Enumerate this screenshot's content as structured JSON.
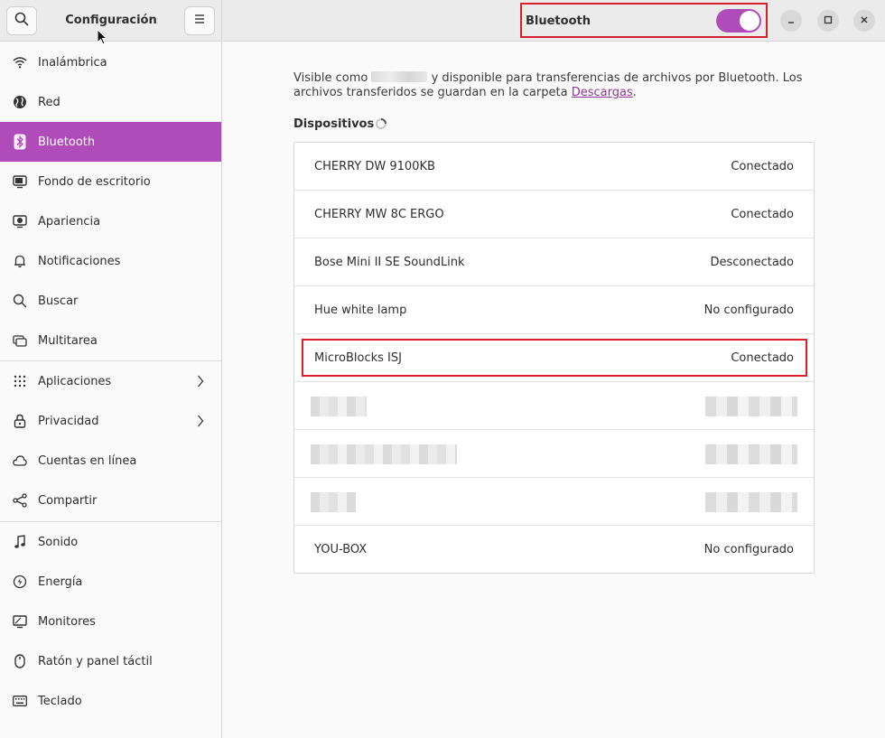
{
  "window": {
    "app_title": "Configuración",
    "panel_title": "Bluetooth",
    "bluetooth_enabled": true,
    "accent_color": "#b04cba"
  },
  "sidebar": {
    "items": [
      {
        "label": "Inalámbrica",
        "icon": "wifi-icon"
      },
      {
        "label": "Red",
        "icon": "globe-icon"
      },
      {
        "label": "Bluetooth",
        "icon": "bluetooth-icon",
        "selected": true
      },
      {
        "label": "Fondo de escritorio",
        "icon": "wallpaper-icon"
      },
      {
        "label": "Apariencia",
        "icon": "appearance-icon"
      },
      {
        "label": "Notificaciones",
        "icon": "bell-icon"
      },
      {
        "label": "Buscar",
        "icon": "search-icon"
      },
      {
        "label": "Multitarea",
        "icon": "multitask-icon"
      },
      {
        "label": "Aplicaciones",
        "icon": "apps-grid-icon",
        "has_submenu": true
      },
      {
        "label": "Privacidad",
        "icon": "lock-icon",
        "has_submenu": true
      },
      {
        "label": "Cuentas en línea",
        "icon": "cloud-icon"
      },
      {
        "label": "Compartir",
        "icon": "share-icon"
      },
      {
        "label": "Sonido",
        "icon": "music-note-icon"
      },
      {
        "label": "Energía",
        "icon": "power-icon"
      },
      {
        "label": "Monitores",
        "icon": "monitor-icon"
      },
      {
        "label": "Ratón y panel táctil",
        "icon": "mouse-icon"
      },
      {
        "label": "Teclado",
        "icon": "keyboard-icon"
      }
    ]
  },
  "main": {
    "description_prefix": "Visible como",
    "description_middle": "y disponible para transferencias de archivos por Bluetooth. Los archivos transferidos se guardan en la carpeta",
    "description_link": "Descargas",
    "description_suffix": ".",
    "devices_heading": "Dispositivos",
    "devices": [
      {
        "name": "CHERRY DW 9100KB",
        "status": "Conectado"
      },
      {
        "name": "CHERRY MW 8C ERGO",
        "status": "Conectado"
      },
      {
        "name": "Bose Mini II SE SoundLink",
        "status": "Desconectado"
      },
      {
        "name": "Hue white lamp",
        "status": "No configurado"
      },
      {
        "name": "MicroBlocks ISJ",
        "status": "Conectado",
        "highlighted": true
      },
      {
        "name": "",
        "status": "",
        "redacted": true
      },
      {
        "name": "",
        "status": "",
        "redacted": true
      },
      {
        "name": "",
        "status": "",
        "redacted": true
      },
      {
        "name": "YOU-BOX",
        "status": "No configurado"
      }
    ]
  }
}
